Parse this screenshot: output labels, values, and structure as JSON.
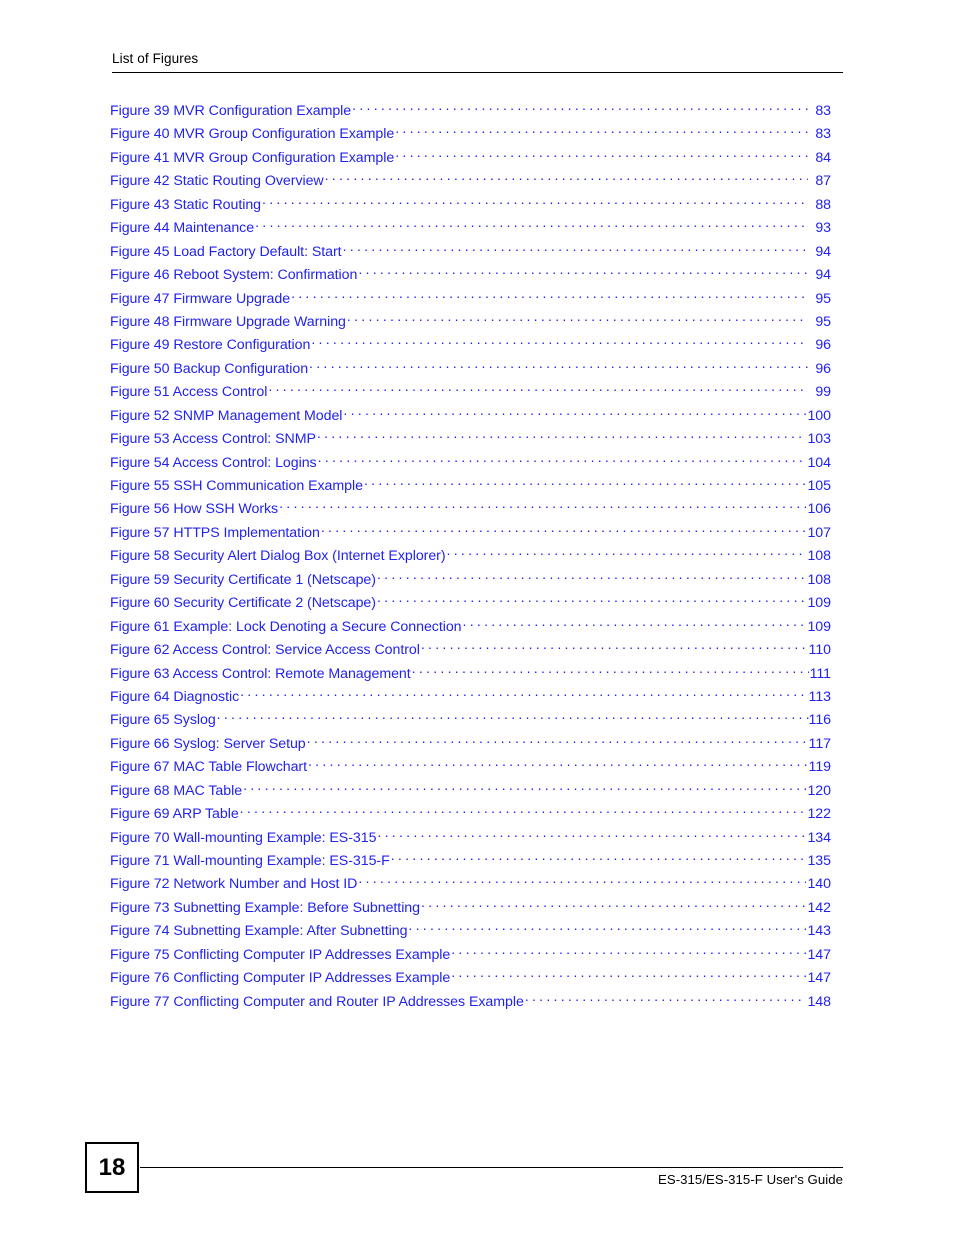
{
  "header": {
    "title": "List of Figures"
  },
  "footer": {
    "page_number": "18",
    "guide_title": "ES-315/ES-315-F User's Guide"
  },
  "toc": {
    "entries": [
      {
        "label": "Figure 39 MVR Configuration Example",
        "page": "83",
        "tight": false
      },
      {
        "label": "Figure 40 MVR Group Configuration Example",
        "page": "83",
        "tight": false
      },
      {
        "label": "Figure 41 MVR Group Configuration Example",
        "page": "84",
        "tight": false
      },
      {
        "label": "Figure 42 Static Routing Overview",
        "page": "87",
        "tight": false
      },
      {
        "label": "Figure 43 Static Routing",
        "page": "88",
        "tight": false
      },
      {
        "label": "Figure 44  Maintenance",
        "page": "93",
        "tight": false
      },
      {
        "label": "Figure 45 Load Factory Default: Start",
        "page": "94",
        "tight": false
      },
      {
        "label": "Figure 46 Reboot System: Confirmation",
        "page": "94",
        "tight": false
      },
      {
        "label": "Figure 47  Firmware Upgrade",
        "page": "95",
        "tight": false
      },
      {
        "label": "Figure 48 Firmware Upgrade Warning",
        "page": "95",
        "tight": false
      },
      {
        "label": "Figure 49 Restore Configuration",
        "page": "96",
        "tight": false
      },
      {
        "label": "Figure 50 Backup Configuration",
        "page": "96",
        "tight": false
      },
      {
        "label": "Figure 51 Access Control",
        "page": "99",
        "tight": false
      },
      {
        "label": "Figure 52 SNMP Management Model",
        "page": "100",
        "tight": false
      },
      {
        "label": "Figure 53 Access Control: SNMP",
        "page": "103",
        "tight": false
      },
      {
        "label": "Figure 54 Access Control: Logins",
        "page": "104",
        "tight": false
      },
      {
        "label": "Figure 55 SSH Communication Example",
        "page": "105",
        "tight": false
      },
      {
        "label": "Figure 56 How SSH Works",
        "page": "106",
        "tight": false
      },
      {
        "label": "Figure 57 HTTPS Implementation",
        "page": "107",
        "tight": false
      },
      {
        "label": "Figure 58 Security Alert Dialog Box (Internet Explorer)",
        "page": "108",
        "tight": false
      },
      {
        "label": "Figure 59 Security Certificate 1 (Netscape)",
        "page": "108",
        "tight": false
      },
      {
        "label": "Figure 60 Security Certificate 2 (Netscape)",
        "page": "109",
        "tight": false
      },
      {
        "label": "Figure 61 Example: Lock Denoting a Secure Connection",
        "page": "109",
        "tight": false
      },
      {
        "label": "Figure 62 Access Control: Service Access Control",
        "page": "110",
        "tight": true
      },
      {
        "label": "Figure 63 Access Control: Remote Management",
        "page": "111",
        "tight": true
      },
      {
        "label": "Figure 64 Diagnostic",
        "page": "113",
        "tight": true
      },
      {
        "label": "Figure 65 Syslog",
        "page": "116",
        "tight": true
      },
      {
        "label": "Figure 66 Syslog: Server Setup",
        "page": "117",
        "tight": true
      },
      {
        "label": "Figure 67 MAC Table Flowchart",
        "page": "119",
        "tight": true
      },
      {
        "label": "Figure 68 MAC Table",
        "page": "120",
        "tight": false
      },
      {
        "label": "Figure 69 ARP Table",
        "page": "122",
        "tight": false
      },
      {
        "label": "Figure 70 Wall-mounting Example: ES-315",
        "page": "134",
        "tight": false
      },
      {
        "label": "Figure 71 Wall-mounting Example: ES-315-F",
        "page": "135",
        "tight": false
      },
      {
        "label": "Figure 72 Network Number and Host ID",
        "page": "140",
        "tight": false
      },
      {
        "label": "Figure 73 Subnetting Example: Before Subnetting",
        "page": "142",
        "tight": false
      },
      {
        "label": "Figure 74 Subnetting Example: After Subnetting",
        "page": "143",
        "tight": false
      },
      {
        "label": "Figure 75 Conflicting Computer IP Addresses Example",
        "page": "147",
        "tight": false
      },
      {
        "label": "Figure 76 Conflicting Computer IP Addresses Example",
        "page": "147",
        "tight": false
      },
      {
        "label": "Figure 77 Conflicting Computer and Router IP Addresses Example",
        "page": "148",
        "tight": false
      }
    ]
  },
  "colors": {
    "link": "#2222ee",
    "text": "#000000",
    "background": "#ffffff"
  }
}
